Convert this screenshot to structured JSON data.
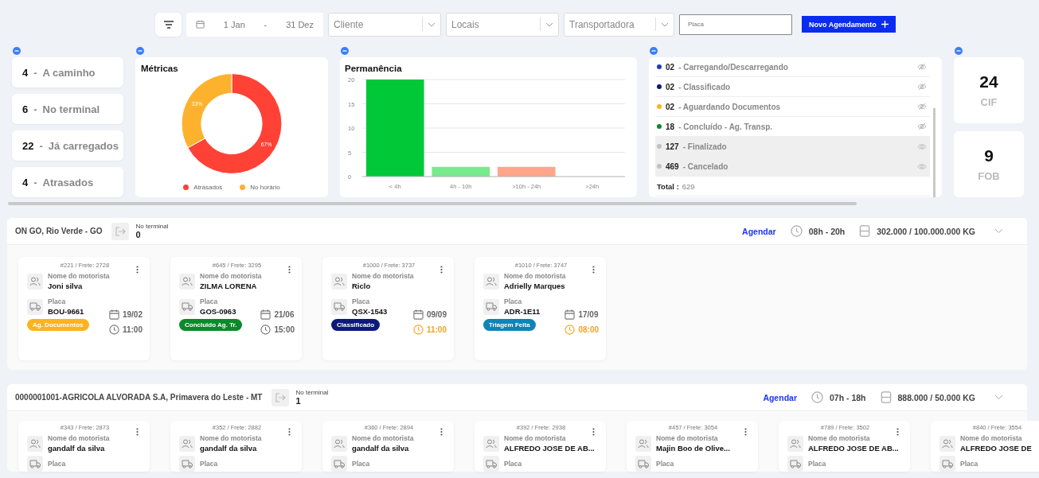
{
  "toolbar": {
    "date_from": "1 Jan",
    "date_separator": "-",
    "date_to": "31 Dez",
    "selects": [
      {
        "placeholder": "Cliente"
      },
      {
        "placeholder": "Locais"
      },
      {
        "placeholder": "Transportadora"
      }
    ],
    "plate_search": {
      "placeholder": "Placa"
    },
    "new_button": "Novo Agendamento"
  },
  "stats": [
    {
      "count": "4",
      "label": "A caminho"
    },
    {
      "count": "6",
      "label": "No terminal"
    },
    {
      "count": "22",
      "label": "Já carregados"
    },
    {
      "count": "4",
      "label": "Atrasados"
    }
  ],
  "stat_separator": "-",
  "metrics": {
    "title": "Métricas",
    "chart_data": {
      "type": "donut",
      "categories": [
        "Atrasados",
        "No horário"
      ],
      "values": [
        67,
        33
      ],
      "value_labels": [
        "67%",
        "33%"
      ]
    },
    "legend": [
      {
        "color": "#ff4136"
      },
      {
        "color": "#fdb22d"
      }
    ]
  },
  "permanence": {
    "title": "Permanência",
    "chart_data": {
      "type": "bar",
      "categories": [
        "< 4h",
        "4h - 10h",
        ">10h - 24h",
        ">24h"
      ],
      "values": [
        20,
        2,
        2,
        0
      ],
      "ylim": [
        0,
        20
      ],
      "yticks": [
        0,
        5,
        10,
        15,
        20
      ],
      "grid": true
    }
  },
  "status_list": {
    "items": [
      {
        "count": "02",
        "label": "Carregando/Descarregando",
        "color": "#1f3fbf",
        "hidden": false
      },
      {
        "count": "02",
        "label": "Classificado",
        "color": "#0c1a70",
        "hidden": false
      },
      {
        "count": "02",
        "label": "Aguardando Documentos",
        "color": "#fbb321",
        "hidden": false
      },
      {
        "count": "18",
        "label": "Concluído - Ag. Transp.",
        "color": "#0a8a2a",
        "hidden": false
      },
      {
        "count": "127",
        "label": "Finalizado",
        "color": "#c0c0c0",
        "hidden": true
      },
      {
        "count": "469",
        "label": "Cancelado",
        "color": "#c0c0c0",
        "hidden": true
      }
    ],
    "separator": "-",
    "total_label": "Total :",
    "total_value": "629"
  },
  "freight": [
    {
      "count": "24",
      "label": "CIF"
    },
    {
      "count": "9",
      "label": "FOB"
    }
  ],
  "sections": [
    {
      "location": "ON GO, Rio Verde - GO",
      "terminal_label": "No terminal",
      "terminal_count": "0",
      "schedule_link": "Agendar",
      "hours": "08h - 20h",
      "capacity": "302.000 / 100.000.000 KG",
      "cards": [
        {
          "header": "#221 / Frete: 2728",
          "driver_label": "Nome do motorista",
          "driver": "Joni silva",
          "plate_label": "Placa",
          "plate": "BOU-9661",
          "date": "19/02",
          "time": "11:00",
          "late": false,
          "status": "Ag. Documentos",
          "color": "#fbb321"
        },
        {
          "header": "#645 / Frete: 3295",
          "driver_label": "Nome do motorista",
          "driver": "ZILMA LORENA",
          "plate_label": "Placa",
          "plate": "GOS-0963",
          "date": "21/06",
          "time": "15:00",
          "late": false,
          "status": "Concluido Ag. Tr.",
          "color": "#0a8a2a"
        },
        {
          "header": "#1000 / Frete: 3737",
          "driver_label": "Nome do motorista",
          "driver": "Riclo",
          "plate_label": "Placa",
          "plate": "QSX-1543",
          "date": "09/09",
          "time": "11:00",
          "late": true,
          "status": "Classificado",
          "color": "#0c1a78"
        },
        {
          "header": "#1010 / Frete: 3747",
          "driver_label": "Nome do motorista",
          "driver": "Adrielly Marques",
          "plate_label": "Placa",
          "plate": "ADR-1E11",
          "date": "17/09",
          "time": "08:00",
          "late": true,
          "status": "Triagem Feita",
          "color": "#0f84b8"
        }
      ]
    },
    {
      "location": "0000001001-AGRICOLA ALVORADA S.A, Primavera do Leste - MT",
      "terminal_label": "No terminal",
      "terminal_count": "1",
      "schedule_link": "Agendar",
      "hours": "07h - 18h",
      "capacity": "888.000 / 50.000 KG",
      "cards": [
        {
          "header": "#343 / Frete: 2873",
          "driver_label": "Nome do motorista",
          "driver": "gandalf da silva",
          "plate_label": "Placa"
        },
        {
          "header": "#352 / Frete: 2882",
          "driver_label": "Nome do motorista",
          "driver": "gandalf da silva",
          "plate_label": "Placa"
        },
        {
          "header": "#360 / Frete: 2894",
          "driver_label": "Nome do motorista",
          "driver": "gandalf da silva",
          "plate_label": "Placa"
        },
        {
          "header": "#392 / Frete: 2938",
          "driver_label": "Nome do motorista",
          "driver": "ALFREDO JOSE DE AB...",
          "plate_label": "Placa"
        },
        {
          "header": "#457 / Frete: 3054",
          "driver_label": "Nome do motorista",
          "driver": "Majin Boo de Olive...",
          "plate_label": "Placa"
        },
        {
          "header": "#789 / Frete: 3502",
          "driver_label": "Nome do motorista",
          "driver": "ALFREDO JOSE DE AB...",
          "plate_label": "Placa"
        },
        {
          "header": "#840 / Frete: 3554",
          "driver_label": "Nome do motorista",
          "driver": "ALFREDO JOSE DE",
          "plate_label": "Placa"
        }
      ]
    }
  ]
}
